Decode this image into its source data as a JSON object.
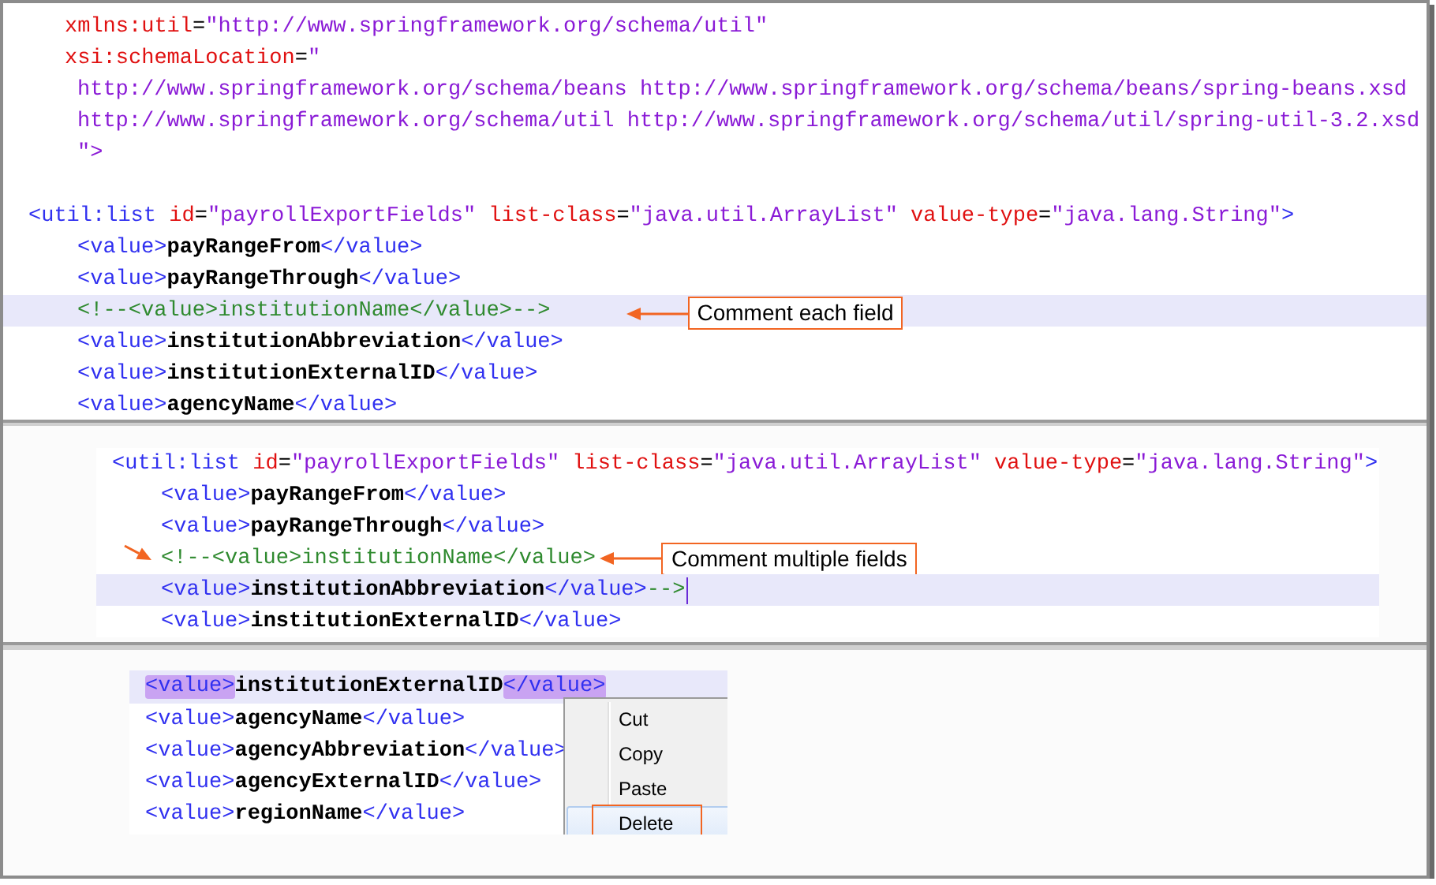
{
  "panels": [
    {
      "lines": [
        {
          "kind": "attr",
          "highlighted": false,
          "tokens": [
            {
              "kind": "attr",
              "text": "xmlns:util"
            },
            {
              "kind": "plain",
              "text": "="
            },
            {
              "kind": "string",
              "text": "\"http://www.springframework.org/schema/util\""
            }
          ]
        },
        {
          "kind": "attr",
          "highlighted": false,
          "tokens": [
            {
              "kind": "attr",
              "text": "xsi:schemaLocation"
            },
            {
              "kind": "plain",
              "text": "="
            },
            {
              "kind": "string",
              "text": "\""
            }
          ]
        },
        {
          "kind": "url",
          "highlighted": false,
          "tokens": [
            {
              "kind": "string",
              "text": "http://www.springframework.org/schema/beans http://www.springframework.org/schema/beans/spring-beans.xsd"
            }
          ]
        },
        {
          "kind": "url",
          "highlighted": false,
          "tokens": [
            {
              "kind": "string",
              "text": "http://www.springframework.org/schema/util http://www.springframework.org/schema/util/spring-util-3.2.xsd"
            }
          ]
        },
        {
          "kind": "url",
          "highlighted": false,
          "tokens": [
            {
              "kind": "string",
              "text": "\">"
            }
          ]
        },
        {
          "kind": "blank"
        },
        {
          "kind": "element",
          "highlighted": false,
          "tokens": [
            {
              "kind": "tag",
              "text": "<util:list "
            },
            {
              "kind": "attr",
              "text": "id"
            },
            {
              "kind": "plain",
              "text": "="
            },
            {
              "kind": "string",
              "text": "\"payrollExportFields\" "
            },
            {
              "kind": "attr",
              "text": "list-class"
            },
            {
              "kind": "plain",
              "text": "="
            },
            {
              "kind": "string",
              "text": "\"java.util.ArrayList\" "
            },
            {
              "kind": "attr",
              "text": "value-type"
            },
            {
              "kind": "plain",
              "text": "="
            },
            {
              "kind": "string",
              "text": "\"java.lang.String\""
            },
            {
              "kind": "tag",
              "text": ">"
            }
          ],
          "children": [
            {
              "kind": "element",
              "highlighted": false,
              "tokens": [
                {
                  "kind": "tag",
                  "text": "<value>"
                },
                {
                  "kind": "text",
                  "text": "payRangeFrom"
                },
                {
                  "kind": "tag",
                  "text": "</value>"
                }
              ]
            },
            {
              "kind": "element",
              "highlighted": false,
              "tokens": [
                {
                  "kind": "tag",
                  "text": "<value>"
                },
                {
                  "kind": "text",
                  "text": "payRangeThrough"
                },
                {
                  "kind": "tag",
                  "text": "</value>"
                }
              ]
            },
            {
              "kind": "element",
              "highlighted": true,
              "tokens": [
                {
                  "kind": "comment",
                  "text": "<!--<value>institutionName</value>-->"
                }
              ],
              "callout": {
                "text": "Comment each field",
                "kind": "single"
              }
            },
            {
              "kind": "element",
              "highlighted": false,
              "tokens": [
                {
                  "kind": "tag",
                  "text": "<value>"
                },
                {
                  "kind": "text",
                  "text": "institutionAbbreviation"
                },
                {
                  "kind": "tag",
                  "text": "</value>"
                }
              ]
            },
            {
              "kind": "element",
              "highlighted": false,
              "tokens": [
                {
                  "kind": "tag",
                  "text": "<value>"
                },
                {
                  "kind": "text",
                  "text": "institutionExternalID"
                },
                {
                  "kind": "tag",
                  "text": "</value>"
                }
              ]
            },
            {
              "kind": "element",
              "highlighted": false,
              "tokens": [
                {
                  "kind": "tag",
                  "text": "<value>"
                },
                {
                  "kind": "text",
                  "text": "agencyName"
                },
                {
                  "kind": "tag",
                  "text": "</value>"
                }
              ]
            }
          ]
        }
      ]
    },
    {
      "lines": [
        {
          "kind": "element",
          "highlighted": false,
          "tokens": [
            {
              "kind": "tag",
              "text": "<util:list "
            },
            {
              "kind": "attr",
              "text": "id"
            },
            {
              "kind": "plain",
              "text": "="
            },
            {
              "kind": "string",
              "text": "\"payrollExportFields\" "
            },
            {
              "kind": "attr",
              "text": "list-class"
            },
            {
              "kind": "plain",
              "text": "="
            },
            {
              "kind": "string",
              "text": "\"java.util.ArrayList\" "
            },
            {
              "kind": "attr",
              "text": "value-type"
            },
            {
              "kind": "plain",
              "text": "="
            },
            {
              "kind": "string",
              "text": "\"java.lang.String\""
            },
            {
              "kind": "tag",
              "text": ">"
            }
          ],
          "children": [
            {
              "kind": "element",
              "highlighted": false,
              "tokens": [
                {
                  "kind": "tag",
                  "text": "<value>"
                },
                {
                  "kind": "text",
                  "text": "payRangeFrom"
                },
                {
                  "kind": "tag",
                  "text": "</value>"
                }
              ]
            },
            {
              "kind": "element",
              "highlighted": false,
              "tokens": [
                {
                  "kind": "tag",
                  "text": "<value>"
                },
                {
                  "kind": "text",
                  "text": "payRangeThrough"
                },
                {
                  "kind": "tag",
                  "text": "</value>"
                }
              ]
            },
            {
              "kind": "element",
              "highlighted": false,
              "marker": true,
              "tokens": [
                {
                  "kind": "comment",
                  "text": "<!--<value>institutionName</value>"
                }
              ],
              "callout": {
                "text": "Comment multiple fields",
                "kind": "double"
              }
            },
            {
              "kind": "element",
              "highlighted": true,
              "cursor": true,
              "tokens": [
                {
                  "kind": "tag",
                  "text": "<value>"
                },
                {
                  "kind": "text",
                  "text": "institutionAbbreviation"
                },
                {
                  "kind": "tag",
                  "text": "</value>"
                },
                {
                  "kind": "comment",
                  "text": "-->"
                }
              ]
            },
            {
              "kind": "element",
              "highlighted": false,
              "tokens": [
                {
                  "kind": "tag",
                  "text": "<value>"
                },
                {
                  "kind": "text",
                  "text": "institutionExternalID"
                },
                {
                  "kind": "tag",
                  "text": "</value>"
                }
              ]
            }
          ]
        }
      ]
    },
    {
      "lines": [
        {
          "kind": "element",
          "highlighted": true,
          "tokens": [
            {
              "kind": "tag",
              "text": "<value>",
              "match": true
            },
            {
              "kind": "text",
              "text": "institutionExternalID"
            },
            {
              "kind": "tag",
              "text": "</value>",
              "match": true
            }
          ]
        },
        {
          "kind": "element",
          "highlighted": false,
          "tokens": [
            {
              "kind": "tag",
              "text": "<value>"
            },
            {
              "kind": "text",
              "text": "agencyName"
            },
            {
              "kind": "tag",
              "text": "</value>"
            }
          ]
        },
        {
          "kind": "element",
          "highlighted": false,
          "tokens": [
            {
              "kind": "tag",
              "text": "<value>"
            },
            {
              "kind": "text",
              "text": "agencyAbbreviation"
            },
            {
              "kind": "tag",
              "text": "</value>"
            }
          ]
        },
        {
          "kind": "element",
          "highlighted": false,
          "tokens": [
            {
              "kind": "tag",
              "text": "<value>"
            },
            {
              "kind": "text",
              "text": "agencyExternalID"
            },
            {
              "kind": "tag",
              "text": "</value>"
            }
          ]
        },
        {
          "kind": "element",
          "highlighted": false,
          "tokens": [
            {
              "kind": "tag",
              "text": "<value>"
            },
            {
              "kind": "text",
              "text": "regionName"
            },
            {
              "kind": "tag",
              "text": "</value>"
            }
          ]
        }
      ],
      "context_menu": {
        "items": [
          {
            "label": "Cut",
            "selected": false
          },
          {
            "label": "Copy",
            "selected": false
          },
          {
            "label": "Paste",
            "selected": false
          },
          {
            "label": "Delete",
            "selected": true
          }
        ]
      }
    }
  ]
}
